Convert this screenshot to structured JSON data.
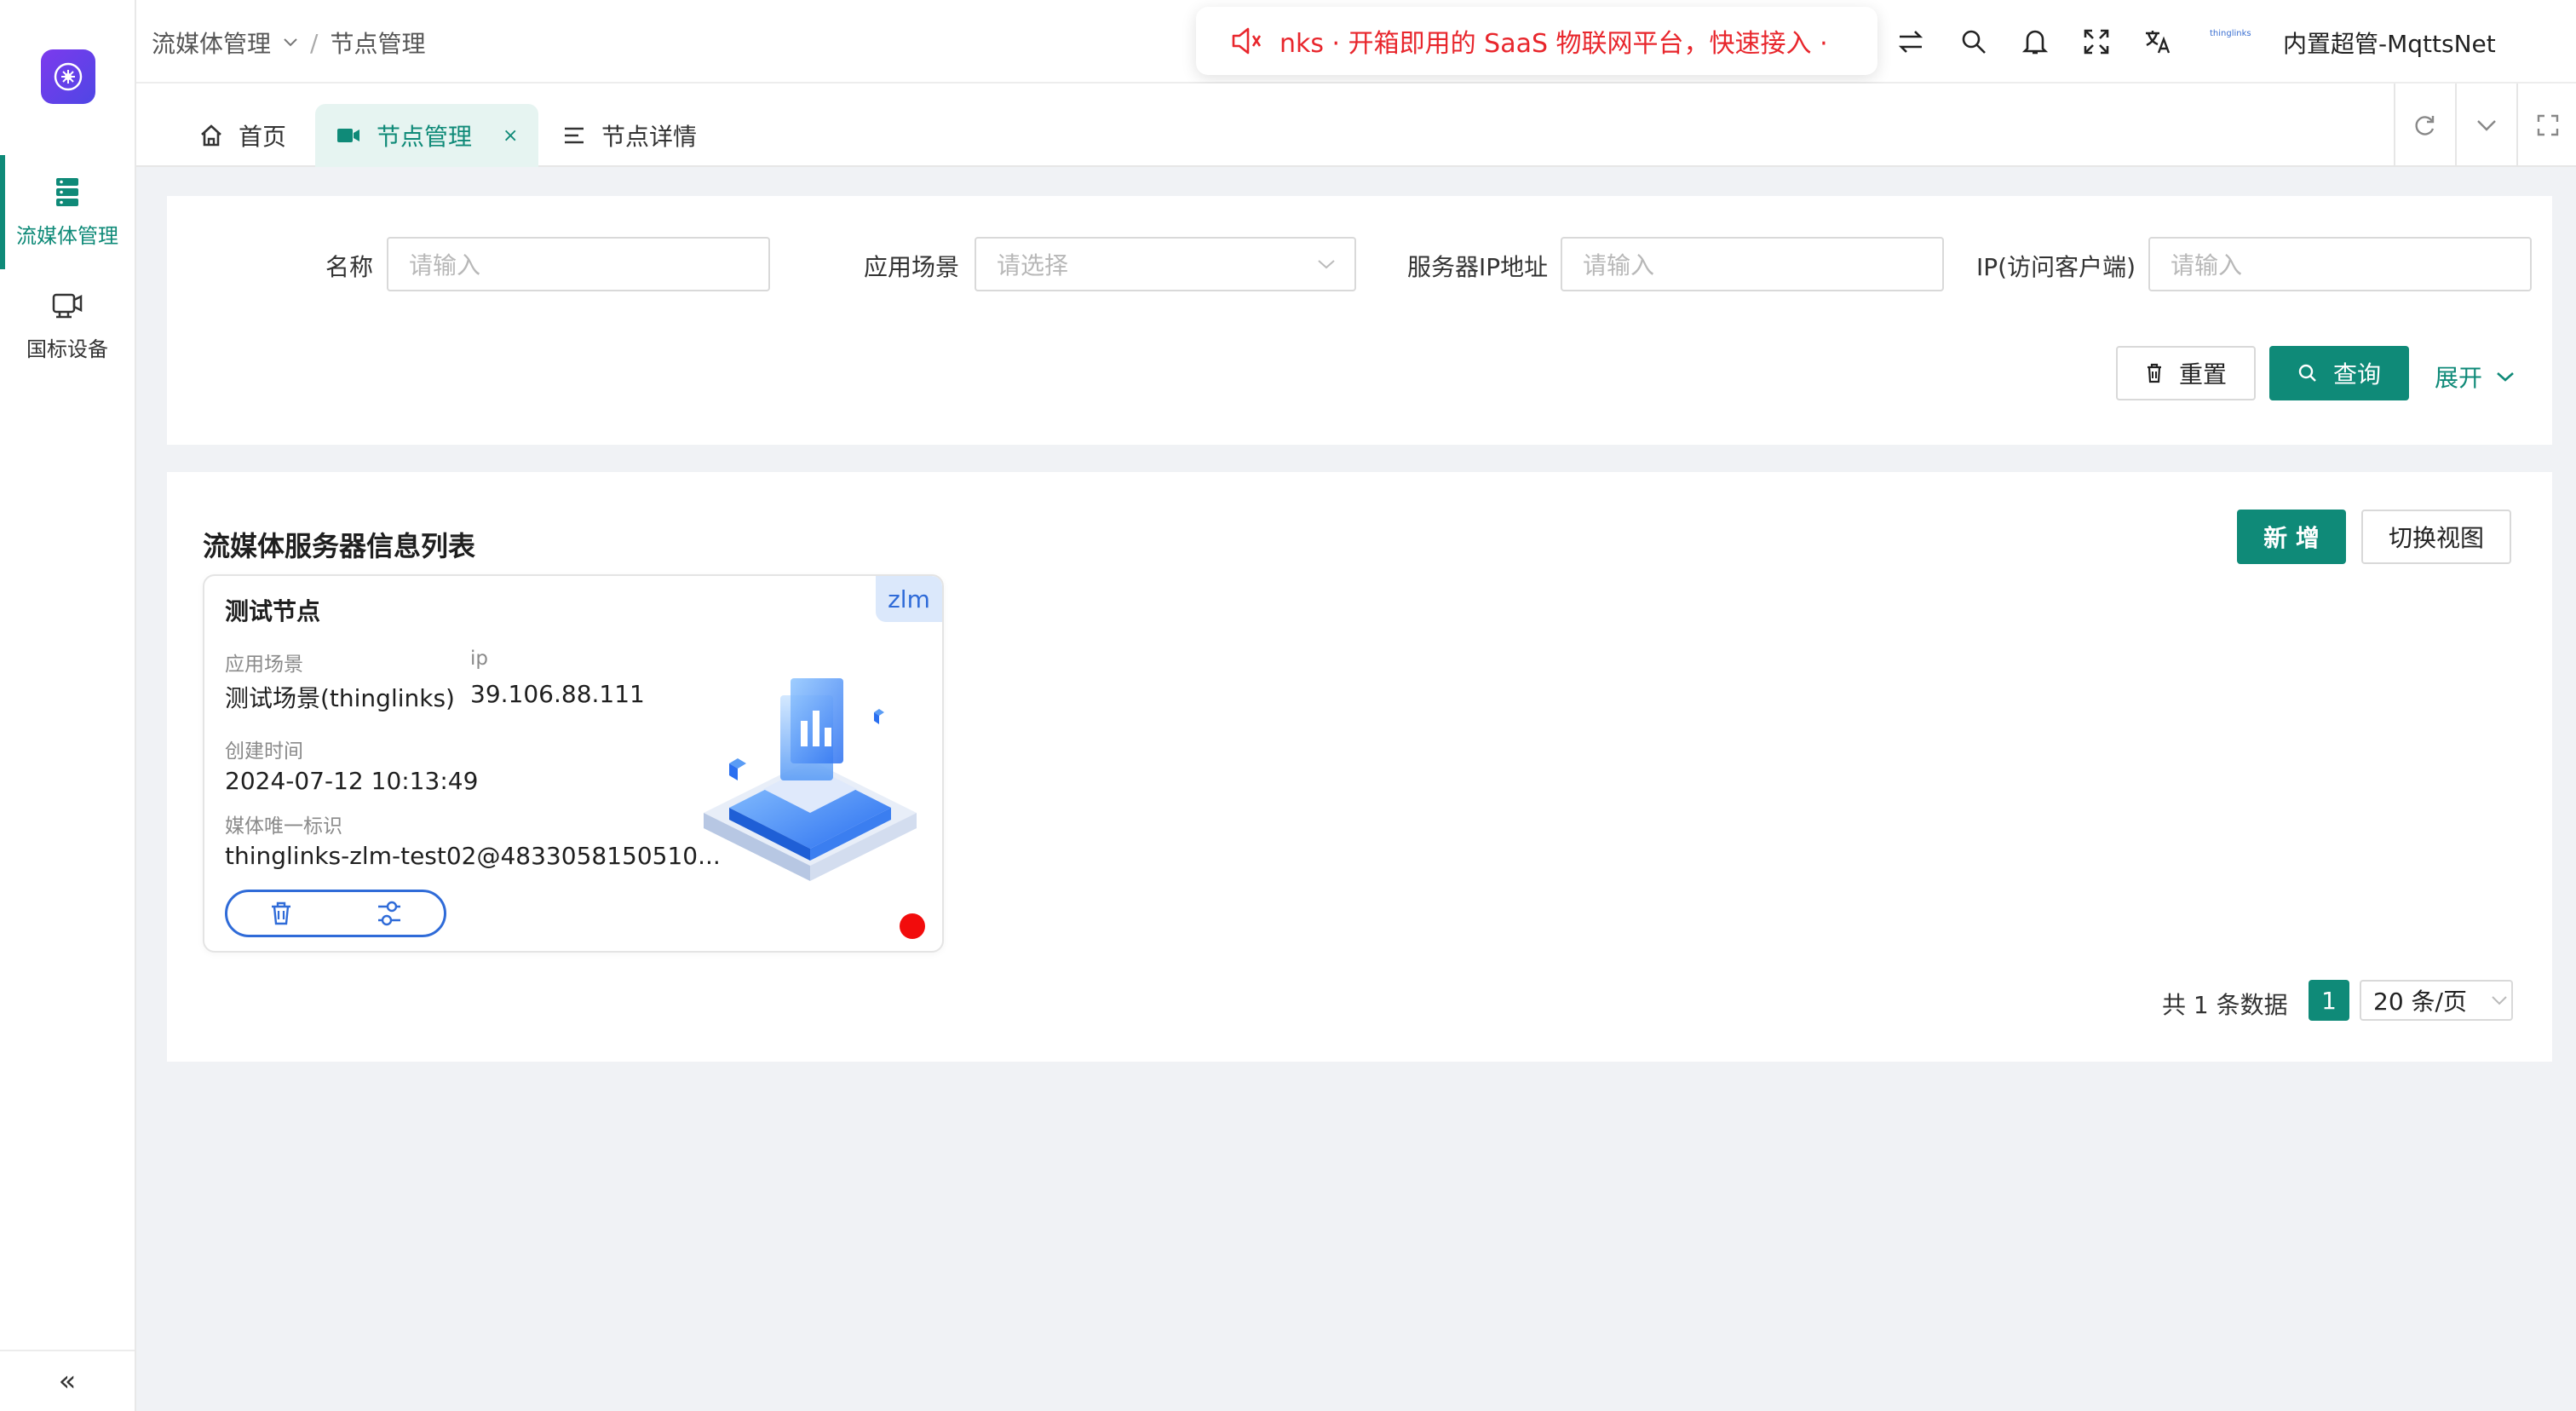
{
  "sidebar": {
    "items": [
      {
        "label": "流媒体管理",
        "icon": "server-icon",
        "active": true
      },
      {
        "label": "国标设备",
        "icon": "camera-device-icon",
        "active": false
      }
    ],
    "collapse_glyph": "«"
  },
  "header": {
    "breadcrumb": [
      "流媒体管理",
      "节点管理"
    ],
    "breadcrumb_sep": "/",
    "notice": "nks · 开箱即用的 SaaS 物联网平台，快速接入 ·",
    "user_name": "内置超管-MqttsNet",
    "brand_mini": "thinglinks"
  },
  "tabs": [
    {
      "label": "首页",
      "icon": "home-icon",
      "active": false
    },
    {
      "label": "节点管理",
      "icon": "video-icon",
      "active": true,
      "close": "×"
    },
    {
      "label": "节点详情",
      "icon": "list-icon",
      "active": false
    }
  ],
  "search": {
    "name_label": "名称",
    "name_placeholder": "请输入",
    "scene_label": "应用场景",
    "scene_placeholder": "请选择",
    "server_ip_label": "服务器IP地址",
    "server_ip_placeholder": "请输入",
    "client_ip_label": "IP(访问客户端)",
    "client_ip_placeholder": "请输入",
    "reset_label": "重置",
    "query_label": "查询",
    "expand_label": "展开"
  },
  "list": {
    "title": "流媒体服务器信息列表",
    "add_label": "新 增",
    "switch_view_label": "切换视图"
  },
  "card": {
    "badge": "zlm",
    "title": "测试节点",
    "scene_key": "应用场景",
    "scene_value": "测试场景(thinglinks)",
    "ip_key": "ip",
    "ip_value": "39.106.88.111",
    "created_key": "创建时间",
    "created_value": "2024-07-12 10:13:49",
    "media_id_key": "媒体唯一标识",
    "media_id_value": "thinglinks-zlm-test02@4833058150510...",
    "status_color": "#f20c0c"
  },
  "pagination": {
    "total_text": "共 1 条数据",
    "current_page": "1",
    "page_size": "20 条/页"
  },
  "colors": {
    "accent": "#0f8a78",
    "notice": "#e8262c",
    "badge_text": "#2f6bd8"
  }
}
